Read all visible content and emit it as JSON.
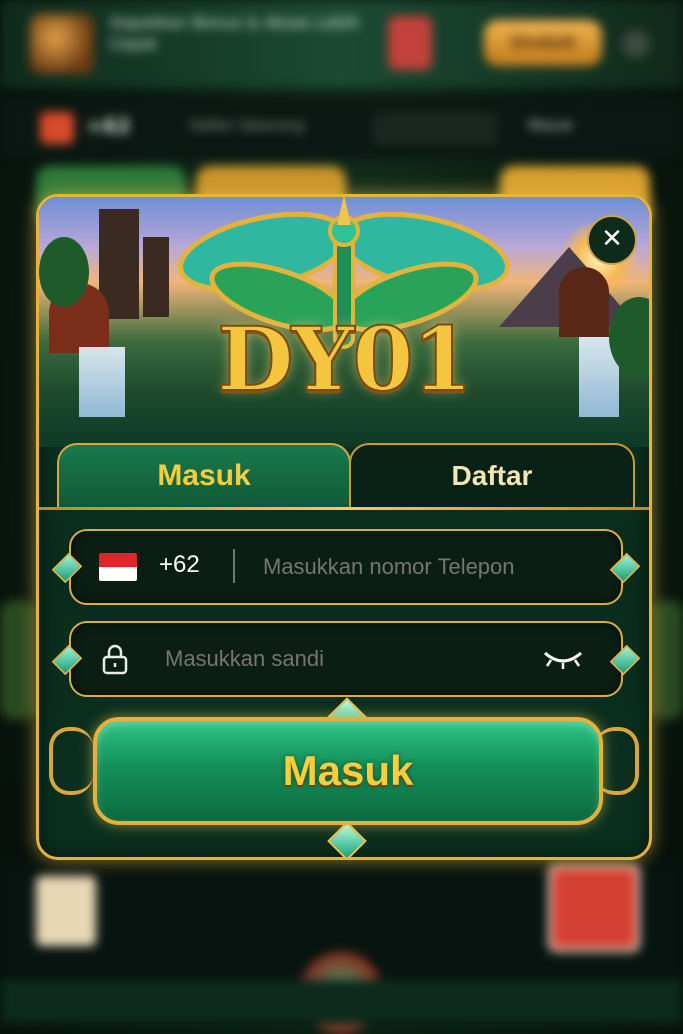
{
  "background": {
    "banner_text": "Dapatkan Bonus & Akses Lebih Cepat",
    "banner_button": "Unduh",
    "balance": "+62",
    "bar_item": "Daftar Sekarang",
    "bar_right": "Masuk"
  },
  "modal": {
    "logo": "DY01",
    "close_icon": "close-icon",
    "tabs": [
      {
        "label": "Masuk",
        "active": true
      },
      {
        "label": "Daftar",
        "active": false
      }
    ],
    "phone": {
      "country_code": "+62",
      "placeholder": "Masukkan nomor Telepon",
      "flag_icon": "indonesia-flag-icon"
    },
    "password": {
      "placeholder": "Masukkan sandi",
      "lock_icon": "lock-icon",
      "eye_icon": "eye-closed-icon"
    },
    "submit_label": "Masuk"
  },
  "colors": {
    "gold": "#e6b33c",
    "green": "#14905a",
    "dark": "#0b1e14"
  }
}
